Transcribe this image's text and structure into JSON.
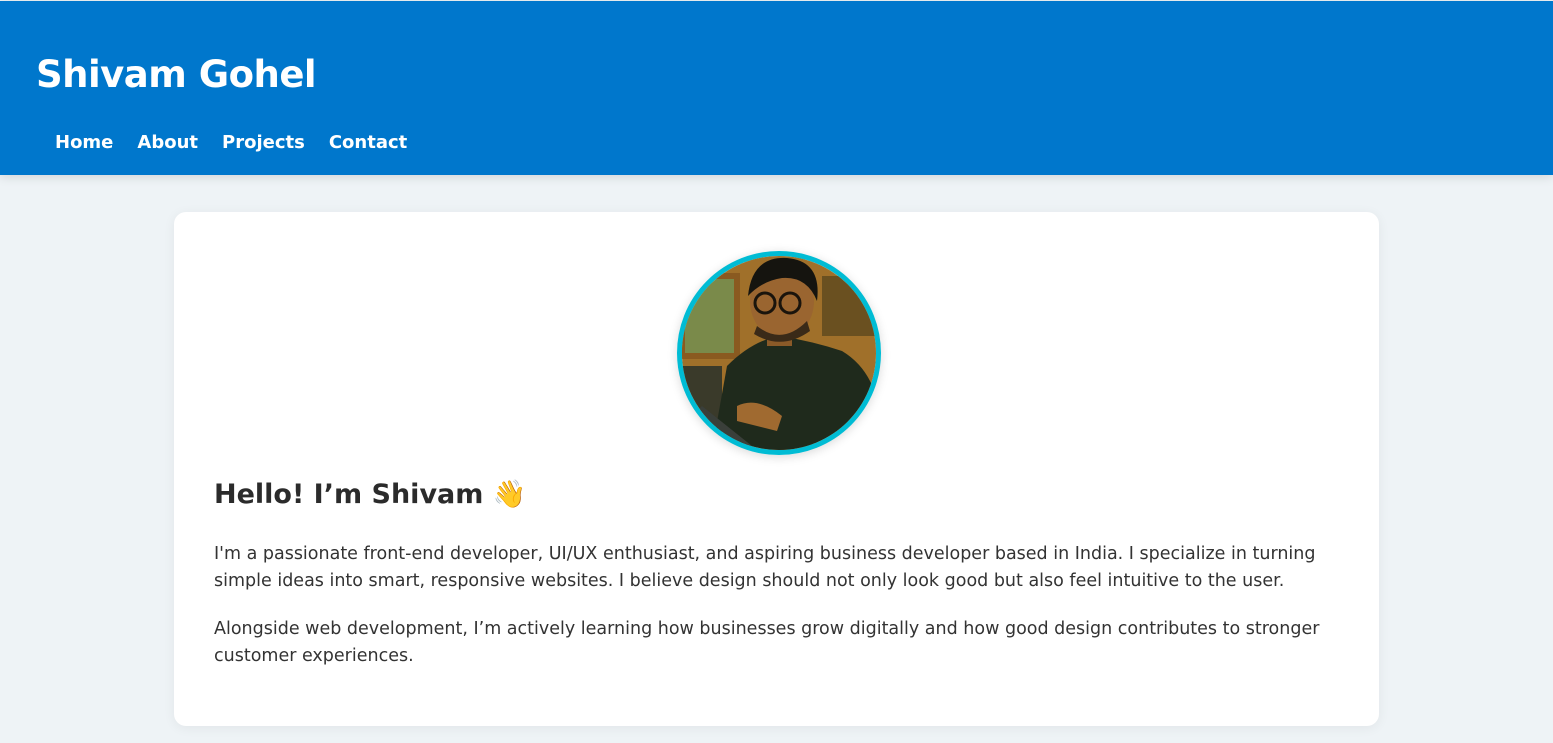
{
  "header": {
    "title": "Shivam Gohel",
    "nav": [
      "Home",
      "About",
      "Projects",
      "Contact"
    ],
    "color": "#0077cc"
  },
  "about": {
    "avatar_border_color": "#00bcd4",
    "heading": "Hello! I’m Shivam 👋",
    "paragraphs": [
      "I'm a passionate front-end developer, UI/UX enthusiast, and aspiring business developer based in India. I specialize in turning simple ideas into smart, responsive websites. I believe design should not only look good but also feel intuitive to the user.",
      "Alongside web development, I’m actively learning how businesses grow digitally and how good design contributes to stronger customer experiences."
    ]
  }
}
